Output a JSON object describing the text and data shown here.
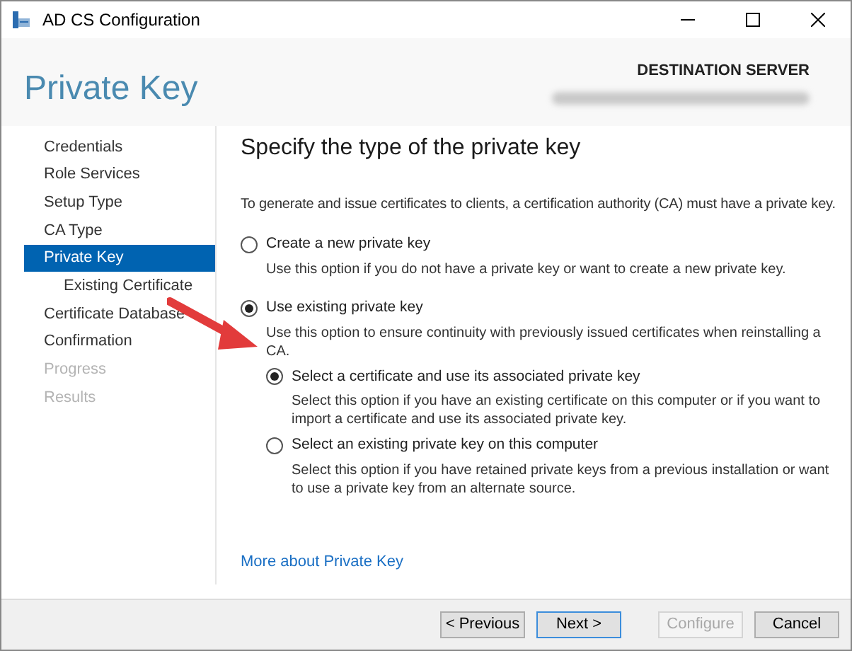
{
  "window": {
    "title": "AD CS Configuration"
  },
  "header": {
    "page_title": "Private Key",
    "server_label": "DESTINATION SERVER"
  },
  "sidebar": {
    "items": [
      {
        "label": "Credentials",
        "selected": false,
        "disabled": false
      },
      {
        "label": "Role Services",
        "selected": false,
        "disabled": false
      },
      {
        "label": "Setup Type",
        "selected": false,
        "disabled": false
      },
      {
        "label": "CA Type",
        "selected": false,
        "disabled": false
      },
      {
        "label": "Private Key",
        "selected": true,
        "disabled": false,
        "children": [
          {
            "label": "Existing Certificate",
            "selected": false,
            "disabled": false
          }
        ]
      },
      {
        "label": "Certificate Database",
        "selected": false,
        "disabled": false
      },
      {
        "label": "Confirmation",
        "selected": false,
        "disabled": false
      },
      {
        "label": "Progress",
        "selected": false,
        "disabled": true
      },
      {
        "label": "Results",
        "selected": false,
        "disabled": true
      }
    ]
  },
  "content": {
    "heading": "Specify the type of the private key",
    "intro": "To generate and issue certificates to clients, a certification authority (CA) must have a private key.",
    "options": [
      {
        "label": "Create a new private key",
        "description": "Use this option if you do not have a private key or want to create a new private key.",
        "selected": false
      },
      {
        "label": "Use existing private key",
        "description": "Use this option to ensure continuity with previously issued certificates when reinstalling a CA.",
        "selected": true,
        "children": [
          {
            "label": "Select a certificate and use its associated private key",
            "description": "Select this option if you have an existing certificate on this computer or if you want to import a certificate and use its associated private key.",
            "selected": true
          },
          {
            "label": "Select an existing private key on this computer",
            "description": "Select this option if you have retained private keys from a previous installation or want to use a private key from an alternate source.",
            "selected": false
          }
        ]
      }
    ],
    "link": "More about Private Key"
  },
  "buttons": [
    {
      "label": "< Previous",
      "disabled": false,
      "default": false
    },
    {
      "label": "Next >",
      "disabled": false,
      "default": true
    },
    {
      "label": "Configure",
      "disabled": true,
      "default": false
    },
    {
      "label": "Cancel",
      "disabled": false,
      "default": false
    }
  ]
}
